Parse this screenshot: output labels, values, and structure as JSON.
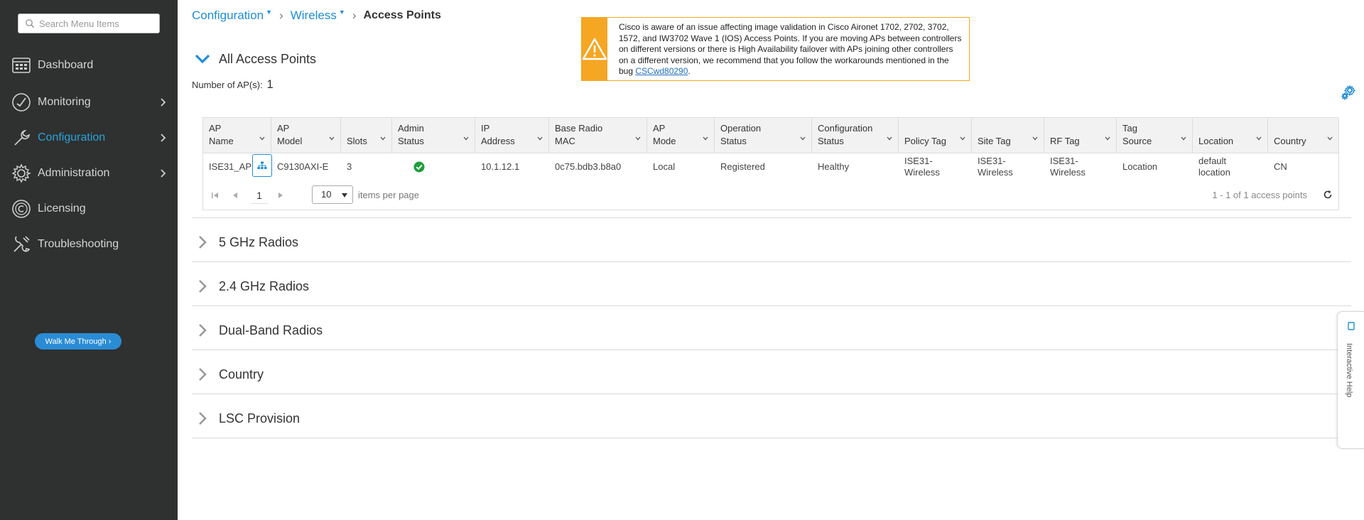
{
  "sidebar": {
    "search_placeholder": "Search Menu Items",
    "items": [
      {
        "label": "Dashboard",
        "icon": "dashboard-icon"
      },
      {
        "label": "Monitoring",
        "icon": "monitoring-icon"
      },
      {
        "label": "Configuration",
        "icon": "configuration-icon",
        "active": true
      },
      {
        "label": "Administration",
        "icon": "administration-icon"
      },
      {
        "label": "Licensing",
        "icon": "licensing-icon"
      },
      {
        "label": "Troubleshooting",
        "icon": "troubleshooting-icon"
      }
    ],
    "walk_me_label": "Walk Me Through ›"
  },
  "breadcrumb": {
    "level1": "Configuration",
    "level2": "Wireless",
    "current": "Access Points"
  },
  "alert": {
    "text_before_link": "Cisco is aware of an issue affecting image validation in Cisco Aironet 1702, 2702, 3702, 1572, and IW3702 Wave 1 (IOS) Access Points. If you are moving APs between controllers on different versions or there is High Availability failover with APs joining other controllers on a different version, we recommend that you follow the workarounds mentioned in the bug ",
    "link_text": "CSCwd80290",
    "text_after_link": "."
  },
  "all_aps": {
    "title": "All Access Points",
    "count_label": "Number of AP(s):",
    "count": "1",
    "columns": [
      {
        "line1": "AP",
        "line2": "Name"
      },
      {
        "line1": "AP",
        "line2": "Model"
      },
      {
        "line1": "",
        "line2": "Slots"
      },
      {
        "line1": "Admin",
        "line2": "Status"
      },
      {
        "line1": "IP",
        "line2": "Address"
      },
      {
        "line1": "Base Radio",
        "line2": "MAC"
      },
      {
        "line1": "AP",
        "line2": "Mode"
      },
      {
        "line1": "Operation",
        "line2": "Status"
      },
      {
        "line1": "Configuration",
        "line2": "Status"
      },
      {
        "line1": "",
        "line2": "Policy Tag"
      },
      {
        "line1": "",
        "line2": "Site Tag"
      },
      {
        "line1": "",
        "line2": "RF Tag"
      },
      {
        "line1": "Tag",
        "line2": "Source"
      },
      {
        "line1": "",
        "line2": "Location"
      },
      {
        "line1": "",
        "line2": "Country"
      }
    ],
    "rows": [
      {
        "ap_name": "ISE31_AP",
        "ap_model": "C9130AXI-E",
        "slots": "3",
        "admin_status": "enabled",
        "ip_address": "10.1.12.1",
        "base_radio_mac": "0c75.bdb3.b8a0",
        "ap_mode": "Local",
        "operation_status": "Registered",
        "configuration_status": "Healthy",
        "policy_tag": "ISE31-Wireless",
        "site_tag": "ISE31-Wireless",
        "rf_tag": "ISE31-Wireless",
        "tag_source": "Location",
        "location": "default location",
        "country": "CN"
      }
    ],
    "pager": {
      "page": "1",
      "per_page": "10",
      "per_page_label": "items per page",
      "range": "1 - 1 of 1 access points"
    }
  },
  "sections": [
    "5 GHz Radios",
    "2.4 GHz Radios",
    "Dual-Band Radios",
    "Country",
    "LSC Provision"
  ],
  "help_tab": {
    "label": "Interactive Help"
  },
  "colors": {
    "sidebar_bg": "#2f3030",
    "accent": "#1f8dd6",
    "active_nav": "#27a5d8",
    "warning": "#f5a623",
    "ok_green": "#1e9e3a"
  }
}
